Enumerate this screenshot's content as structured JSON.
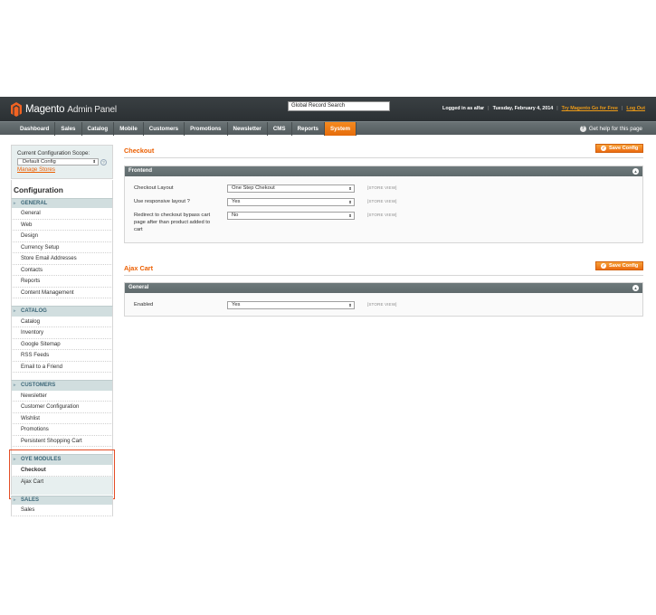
{
  "header": {
    "logo_brand": "Magento",
    "logo_sub": "Admin Panel",
    "search_value": "Global Record Search",
    "logged_in": "Logged in as alfar",
    "date": "Tuesday, February 4, 2014",
    "try_link": "Try Magento Go for Free",
    "logout": "Log Out",
    "help": "Get help for this page",
    "help_icon": "?"
  },
  "nav": {
    "items": [
      "Dashboard",
      "Sales",
      "Catalog",
      "Mobile",
      "Customers",
      "Promotions",
      "Newsletter",
      "CMS",
      "Reports",
      "System"
    ],
    "active": "System",
    "accent_color": "#eb6a11"
  },
  "sidebar": {
    "scope_label": "Current Configuration Scope:",
    "scope_value": "Default Config",
    "manage_stores": "Manage Stores",
    "config_title": "Configuration",
    "sections": [
      {
        "title": "GENERAL",
        "items": [
          "General",
          "Web",
          "Design",
          "Currency Setup",
          "Store Email Addresses",
          "Contacts",
          "Reports",
          "Content Management"
        ]
      },
      {
        "title": "CATALOG",
        "items": [
          "Catalog",
          "Inventory",
          "Google Sitemap",
          "RSS Feeds",
          "Email to a Friend"
        ]
      },
      {
        "title": "CUSTOMERS",
        "items": [
          "Newsletter",
          "Customer Configuration",
          "Wishlist",
          "Promotions",
          "Persistent Shopping Cart"
        ]
      },
      {
        "title": "OYE MODULES",
        "items": [
          "Checkout",
          "Ajax Cart"
        ]
      },
      {
        "title": "SALES",
        "items": [
          "Sales"
        ]
      }
    ]
  },
  "main": {
    "save_label": "Save Config",
    "checkout": {
      "title": "Checkout",
      "group": "Frontend",
      "fields": [
        {
          "label": "Checkout Layout",
          "value": "One Step Chekout",
          "scope": "[STORE VIEW]"
        },
        {
          "label": "Use responsive layout ?",
          "value": "Yes",
          "scope": "[STORE VIEW]"
        },
        {
          "label": "Redirect to checkout bypass cart page after than product added to cart",
          "value": "No",
          "scope": "[STORE VIEW]"
        }
      ]
    },
    "ajax": {
      "title": "Ajax Cart",
      "group": "General",
      "fields": [
        {
          "label": "Enabled",
          "value": "Yes",
          "scope": "[STORE VIEW]"
        }
      ]
    }
  }
}
